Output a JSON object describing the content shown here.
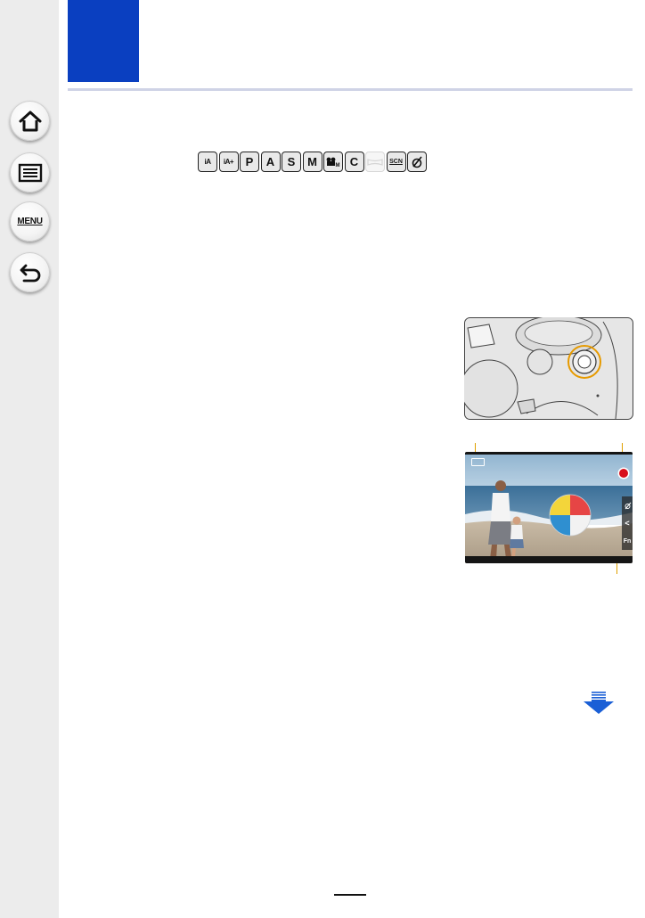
{
  "sidebar": {
    "items": [
      {
        "icon": "home-icon"
      },
      {
        "icon": "table-of-contents-icon"
      },
      {
        "icon": "menu-icon",
        "label": "MENU"
      },
      {
        "icon": "back-icon"
      }
    ]
  },
  "header": {
    "accent_color": "#0a3fc0",
    "rule_color": "#cfd3e6"
  },
  "modes": [
    {
      "label": "iA",
      "state": "enabled"
    },
    {
      "label": "iA+",
      "state": "enabled"
    },
    {
      "label": "P",
      "state": "enabled"
    },
    {
      "label": "A",
      "state": "enabled"
    },
    {
      "label": "S",
      "state": "enabled"
    },
    {
      "label": "M",
      "state": "enabled"
    },
    {
      "label": "M",
      "state": "enabled"
    },
    {
      "label": "C",
      "state": "enabled"
    },
    {
      "label": "",
      "state": "disabled"
    },
    {
      "label": "SCN",
      "state": "enabled"
    },
    {
      "label": "",
      "state": "enabled"
    }
  ],
  "screen": {
    "side_tabs": [
      "<",
      "Fn"
    ],
    "rec_color": "#d8101c",
    "callout_color": "#e0a000"
  },
  "next_page_icon": "arrow-down-icon",
  "next_page_color": "#1a5fd6"
}
